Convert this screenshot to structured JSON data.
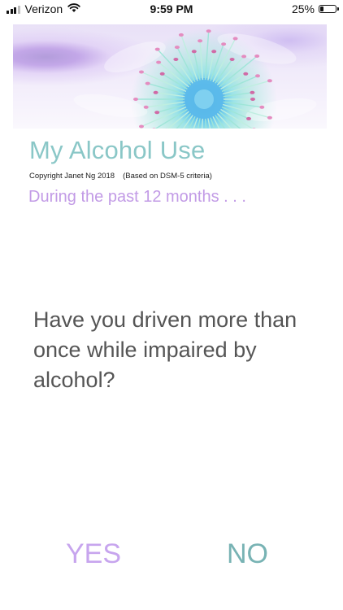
{
  "status_bar": {
    "carrier": "Verizon",
    "time": "9:59 PM",
    "battery_percent_label": "25%",
    "battery_level": 0.25,
    "icons": [
      "cellular-signal-icon",
      "wifi-icon",
      "battery-icon"
    ]
  },
  "header": {
    "banner_image": "flower-banner-image",
    "title": "My Alcohol Use",
    "copyright": "Copyright Janet Ng 2018",
    "criteria": "(Based on DSM-5 criteria)",
    "subtitle": "During the past 12 months . . ."
  },
  "question": {
    "text": "Have you driven more than once while impaired by alcohol?"
  },
  "answers": {
    "yes_label": "YES",
    "no_label": "NO"
  },
  "colors": {
    "title": "#8ac7c7",
    "subtitle": "#c29be6",
    "question": "#555555",
    "yes": "#c7a5ee",
    "no": "#78b3b4"
  }
}
